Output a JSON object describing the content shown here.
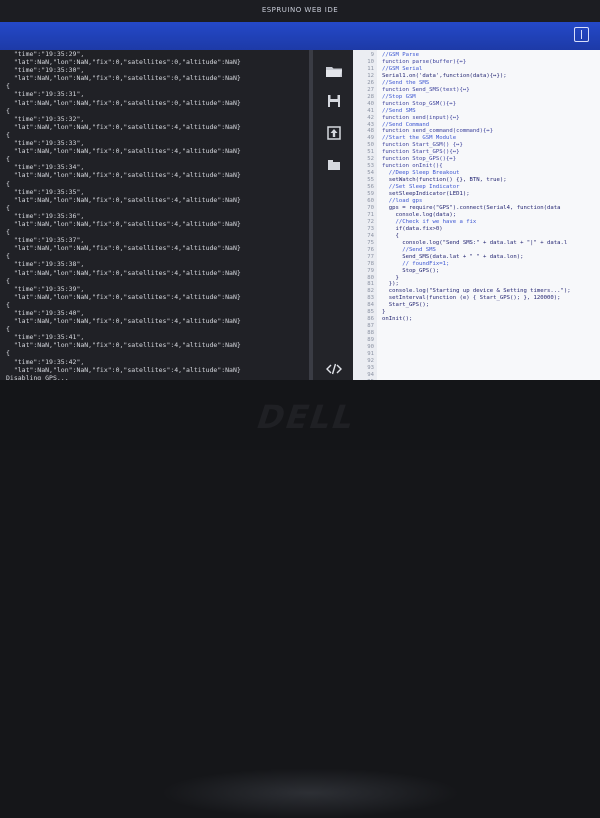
{
  "app": {
    "title": "ESPRUINO WEB IDE"
  },
  "console": {
    "lines": [
      "  \"time\":\"19:35:29\",",
      "  \"lat\":NaN,\"lon\":NaN,\"fix\":0,\"satellites\":0,\"altitude\":NaN}",
      "",
      "  \"time\":\"19:35:30\",",
      "  \"lat\":NaN,\"lon\":NaN,\"fix\":0,\"satellites\":0,\"altitude\":NaN}",
      "{",
      "  \"time\":\"19:35:31\",",
      "  \"lat\":NaN,\"lon\":NaN,\"fix\":0,\"satellites\":0,\"altitude\":NaN}",
      "{",
      "  \"time\":\"19:35:32\",",
      "  \"lat\":NaN,\"lon\":NaN,\"fix\":0,\"satellites\":4,\"altitude\":NaN}",
      "{",
      "  \"time\":\"19:35:33\",",
      "  \"lat\":NaN,\"lon\":NaN,\"fix\":0,\"satellites\":4,\"altitude\":NaN}",
      "{",
      "  \"time\":\"19:35:34\",",
      "  \"lat\":NaN,\"lon\":NaN,\"fix\":0,\"satellites\":4,\"altitude\":NaN}",
      "{",
      "  \"time\":\"19:35:35\",",
      "  \"lat\":NaN,\"lon\":NaN,\"fix\":0,\"satellites\":4,\"altitude\":NaN}",
      "{",
      "  \"time\":\"19:35:36\",",
      "  \"lat\":NaN,\"lon\":NaN,\"fix\":0,\"satellites\":4,\"altitude\":NaN}",
      "{",
      "  \"time\":\"19:35:37\",",
      "  \"lat\":NaN,\"lon\":NaN,\"fix\":0,\"satellites\":4,\"altitude\":NaN}",
      "{",
      "  \"time\":\"19:35:38\",",
      "  \"lat\":NaN,\"lon\":NaN,\"fix\":0,\"satellites\":4,\"altitude\":NaN}",
      "{",
      "  \"time\":\"19:35:39\",",
      "  \"lat\":NaN,\"lon\":NaN,\"fix\":0,\"satellites\":4,\"altitude\":NaN}",
      "{",
      "  \"time\":\"19:35:40\",",
      "  \"lat\":NaN,\"lon\":NaN,\"fix\":0,\"satellites\":4,\"altitude\":NaN}",
      "{",
      "  \"time\":\"19:35:41\",",
      "  \"lat\":NaN,\"lon\":NaN,\"fix\":0,\"satellites\":4,\"altitude\":NaN}",
      "{",
      "  \"time\":\"19:35:42\",",
      "  \"lat\":NaN,\"lon\":NaN,\"fix\":0,\"satellites\":4,\"altitude\":NaN}",
      "Disabling GPS...",
      "=",
      ">"
    ]
  },
  "sidebar": {
    "icons": [
      "open-folder-icon",
      "save-icon",
      "send-to-espruino-icon",
      "flash-icon",
      "code-view-icon"
    ]
  },
  "editor": {
    "line_numbers": [
      "9",
      "10",
      "11",
      "12",
      "26",
      "27",
      "28",
      "40",
      "41",
      "42",
      "43",
      "48",
      "49",
      "50",
      "51",
      "52",
      "53",
      "54",
      "55",
      "56",
      "59",
      "60",
      "70",
      "71",
      "72",
      "73",
      "74",
      "75",
      "76",
      "77",
      "78",
      "79",
      "80",
      "81",
      "82",
      "83",
      "84",
      "85",
      "86",
      "87",
      "88",
      "89",
      "90",
      "91",
      "92",
      "93",
      "94",
      "95",
      "96",
      "97",
      "98",
      "99",
      "100",
      "101",
      "102",
      "103",
      "104",
      "105"
    ],
    "lines": [
      "",
      "//GSM Parse",
      "function parse(buffer){↔}",
      "",
      "//GSM Serial",
      "Serial1.on('data',function(data){↔});",
      "",
      "//Send the SMS",
      "function Send_SMS(text){↔}",
      "",
      "//Stop GSM",
      "function Stop_GSM(){↔}",
      "",
      "//Send SMS",
      "function send(input){↔}",
      "",
      "//Send Command",
      "function send_command(command){↔}",
      "",
      "//Start the GSM Module",
      "function Start_GSM() {↔}",
      "",
      "function Start_GPS(){↔}",
      "",
      "function Stop_GPS(){↔}",
      "",
      "function onInit(){",
      "  //Deep Sleep Breakout",
      "  setWatch(function() {}, BTN, true);",
      "  //Set Sleep Indicator",
      "  setSleepIndicator(LED1);",
      "  //load gps",
      "  gps = require(\"GPS\").connect(Serial4, function(data",
      "    console.log(data);",
      "    //Check if we have a fix",
      "    if(data.fix>0)",
      "    {",
      "      console.log(\"Send SMS:\" + data.lat + \"|\" + data.l",
      "      //Send SMS",
      "      Send_SMS(data.lat + \" \" + data.lon);",
      "      // foundFix=1;",
      "      Stop_GPS();",
      "    }",
      "  });",
      "  console.log(\"Starting up device & Setting timers...\");",
      "  setInterval(function (e) { Start_GPS(); }, 120000);",
      "  Start_GPS();",
      "}",
      "",
      "",
      "onInit();",
      "",
      "",
      "",
      "",
      "",
      "",
      ""
    ]
  },
  "bezel": {
    "brand": "DELL"
  },
  "colors": {
    "toolbar": "#2146c3",
    "console_bg": "#202126",
    "editor_bg": "#f7f8fa",
    "comment": "#3c56d2"
  }
}
